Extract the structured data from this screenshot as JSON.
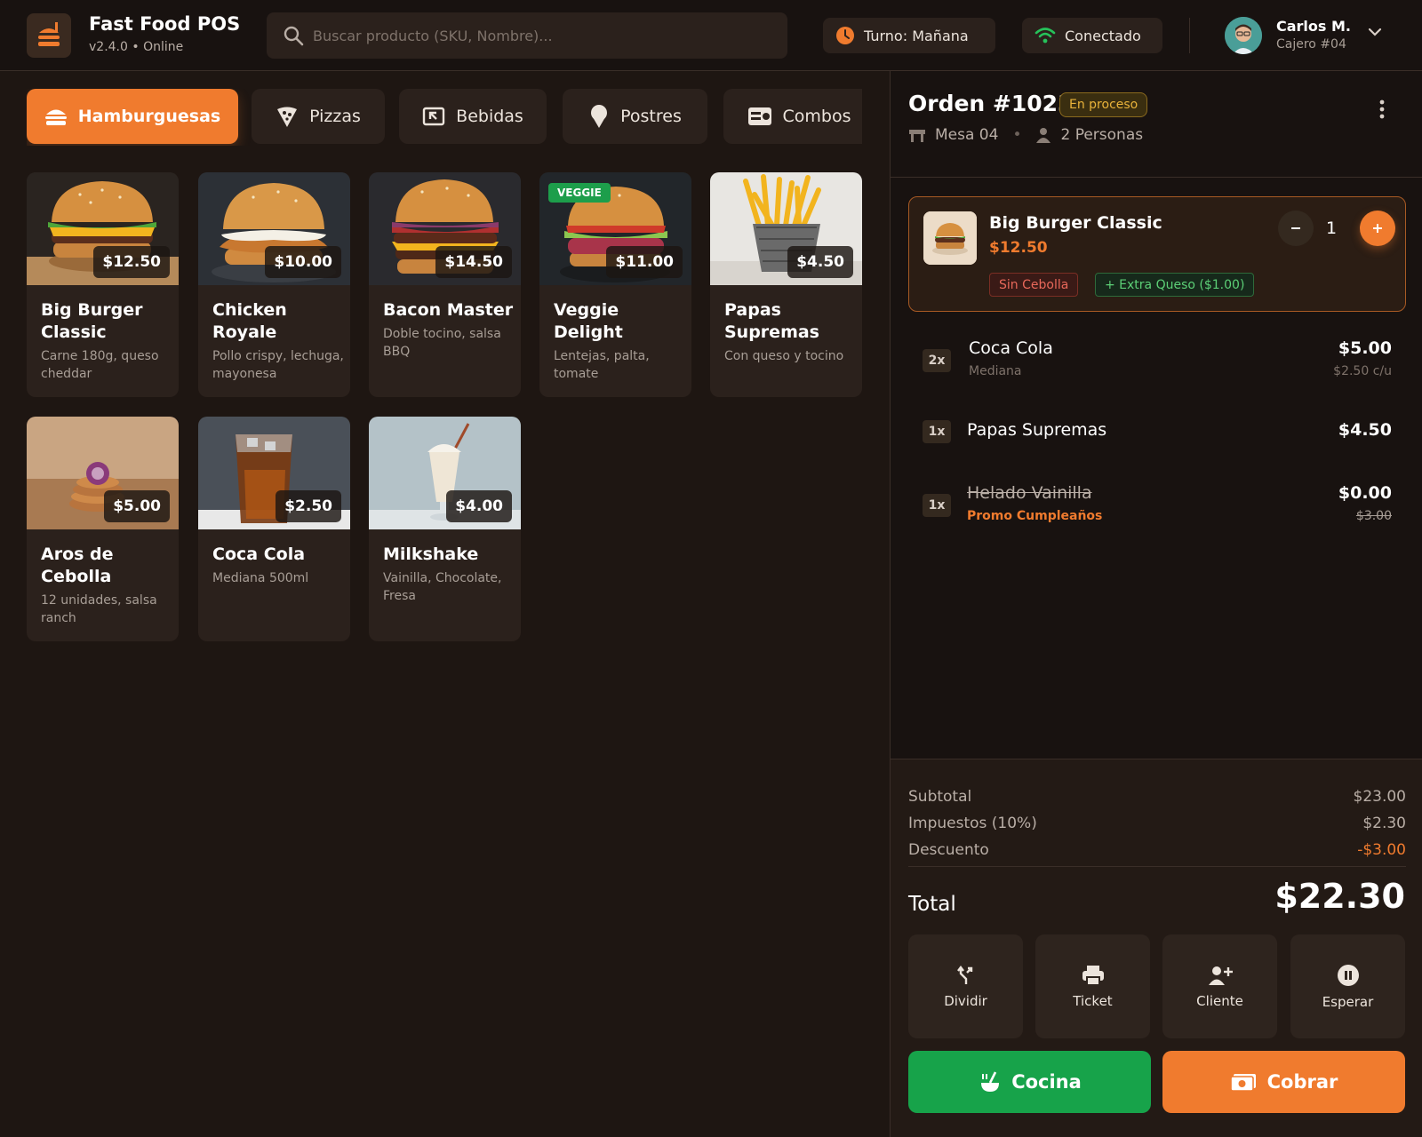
{
  "app": {
    "title": "Fast Food POS",
    "subtitle": "v2.4.0 • Online"
  },
  "search": {
    "placeholder": "Buscar producto (SKU, Nombre)..."
  },
  "status": {
    "shift": "Turno: Mañana",
    "connection": "Conectado"
  },
  "user": {
    "name": "Carlos M.",
    "role": "Cajero #04"
  },
  "categories": [
    {
      "label": "Hamburguesas",
      "icon": "burger-icon",
      "active": true
    },
    {
      "label": "Pizzas",
      "icon": "pizza-icon",
      "active": false
    },
    {
      "label": "Bebidas",
      "icon": "drink-icon",
      "active": false
    },
    {
      "label": "Postres",
      "icon": "ice-cream-icon",
      "active": false
    },
    {
      "label": "Combos",
      "icon": "combo-icon",
      "active": false
    }
  ],
  "products": [
    {
      "name": "Big Burger Classic",
      "price": "$12.50",
      "description": "Carne 180g, queso cheddar",
      "image": "burger"
    },
    {
      "name": "Chicken Royale",
      "price": "$10.00",
      "description": "Pollo crispy, lechuga, mayonesa",
      "image": "chicken"
    },
    {
      "name": "Bacon Master",
      "price": "$14.50",
      "description": "Doble tocino, salsa BBQ",
      "image": "bacon"
    },
    {
      "name": "Veggie Delight",
      "price": "$11.00",
      "description": "Lentejas, palta, tomate",
      "badge": "VEGGIE",
      "image": "veggie"
    },
    {
      "name": "Papas Supremas",
      "price": "$4.50",
      "description": "Con queso y tocino",
      "image": "fries"
    },
    {
      "name": "Aros de Cebolla",
      "price": "$5.00",
      "description": "12 unidades, salsa ranch",
      "image": "onion"
    },
    {
      "name": "Coca Cola",
      "price": "$2.50",
      "description": "Mediana 500ml",
      "image": "cola"
    },
    {
      "name": "Milkshake",
      "price": "$4.00",
      "description": "Vainilla, Chocolate, Fresa",
      "image": "shake"
    }
  ],
  "order": {
    "title": "Orden #1023",
    "status": "En proceso",
    "table": "Mesa 04",
    "guests": "2 Personas",
    "selected_item": {
      "name": "Big Burger Classic",
      "price": "$12.50",
      "quantity": "1",
      "modifier_remove": "Sin Cebolla",
      "modifier_add": "+ Extra Queso ($1.00)"
    },
    "items": [
      {
        "qty": "2x",
        "name": "Coca Cola",
        "sub": "Mediana",
        "price": "$5.00",
        "unit": "$2.50 c/u"
      },
      {
        "qty": "1x",
        "name": "Papas Supremas",
        "price": "$4.50"
      },
      {
        "qty": "1x",
        "name": "Helado Vainilla",
        "promo": "Promo Cumpleaños",
        "price": "$0.00",
        "original_price": "$3.00"
      }
    ],
    "subtotal_label": "Subtotal",
    "subtotal": "$23.00",
    "tax_label": "Impuestos (10%)",
    "tax": "$2.30",
    "discount_label": "Descuento",
    "discount": "-$3.00",
    "total_label": "Total",
    "total": "$22.30"
  },
  "actions": {
    "split": "Dividir",
    "ticket": "Ticket",
    "customer": "Cliente",
    "hold": "Esperar"
  },
  "buttons": {
    "kitchen": "Cocina",
    "charge": "Cobrar"
  },
  "colors": {
    "accent": "#f07b2e",
    "success": "#17a34a",
    "background": "#1e1612",
    "panel": "#181210",
    "card": "#2b211c"
  }
}
